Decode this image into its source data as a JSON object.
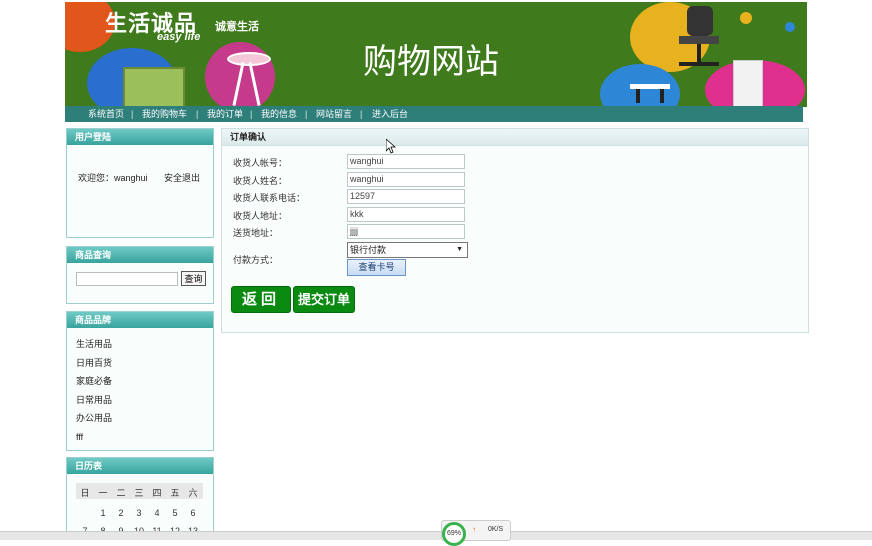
{
  "banner": {
    "brand_cn": "生活诚品",
    "brand_tagline": "诚意生活",
    "brand_en": "easy life",
    "site_title": "购物网站"
  },
  "nav": {
    "items": [
      "系统首页",
      "我的购物车",
      "我的订单",
      "我的信息",
      "网站留言",
      "进入后台"
    ],
    "separator": "|"
  },
  "login": {
    "title": "用户登陆",
    "welcome": "欢迎您：wanghui",
    "logout": "安全退出"
  },
  "search": {
    "title": "商品查询",
    "button": "查询",
    "value": ""
  },
  "brands": {
    "title": "商品品牌",
    "items": [
      "生活用品",
      "日用百货",
      "家庭必备",
      "日常用品",
      "办公用品",
      "fff"
    ]
  },
  "calendar": {
    "title": "日历表",
    "weekdays": [
      "日",
      "一",
      "二",
      "三",
      "四",
      "五",
      "六"
    ],
    "row1": [
      "",
      "1",
      "2",
      "3",
      "4",
      "5",
      "6"
    ],
    "row2": [
      "7",
      "8",
      "9",
      "10",
      "11",
      "12",
      "13"
    ]
  },
  "order": {
    "title": "订单确认",
    "fields": [
      {
        "label": "收货人帐号：",
        "value": "wanghui"
      },
      {
        "label": "收货人姓名：",
        "value": "wanghui"
      },
      {
        "label": "收货人联系电话：",
        "value": "12597"
      },
      {
        "label": "收货人地址：",
        "value": "kkk"
      },
      {
        "label": "送货地址：",
        "value": "jjjj"
      }
    ],
    "payment_label": "付款方式：",
    "payment_selected": "银行付款",
    "view_card": "查看卡号",
    "back": "返回",
    "submit": "提交订单"
  },
  "status": {
    "percent": "69%",
    "speed": "0K/S"
  },
  "colors": {
    "banner_green": "#3f7a1c",
    "nav_teal": "#2e7e7a",
    "panel_head": "#38a39d",
    "button_green": "#0b8a12"
  }
}
